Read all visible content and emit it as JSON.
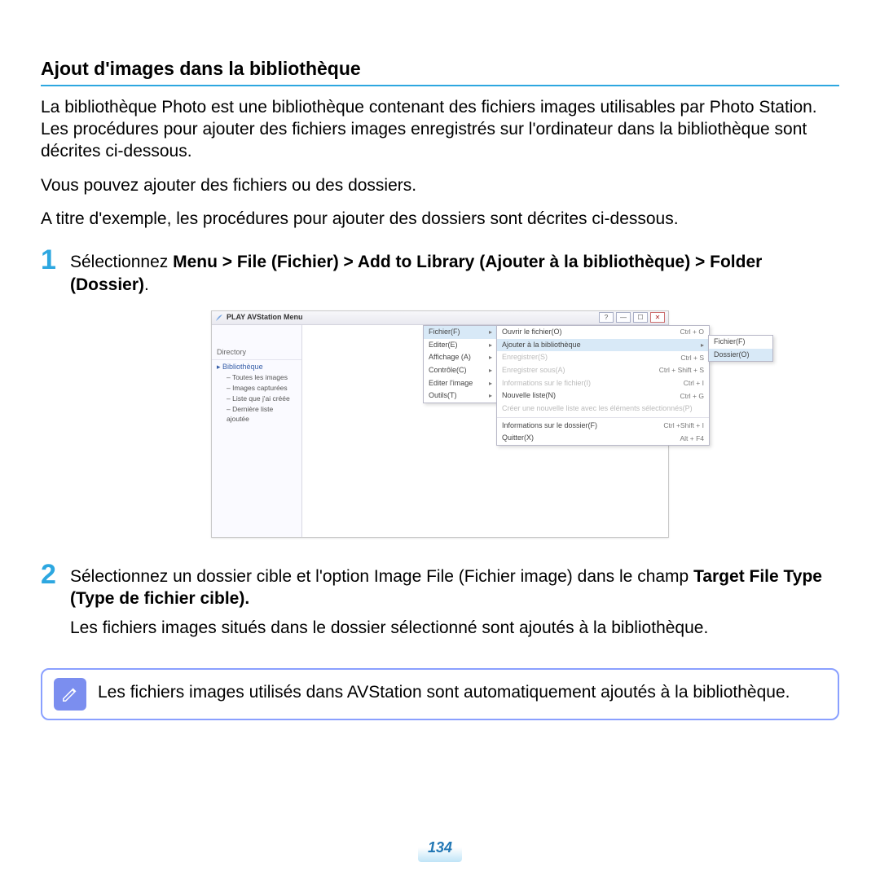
{
  "section_title": "Ajout d'images dans la bibliothèque",
  "intro_p1": "La bibliothèque Photo est une bibliothèque contenant des fichiers images utilisables par Photo Station. Les procédures pour ajouter des fichiers images enregistrés sur l'ordinateur dans la bibliothèque sont décrites ci-dessous.",
  "intro_p2": "Vous pouvez ajouter des fichiers ou des dossiers.",
  "intro_p3": "A titre d'exemple, les procédures pour ajouter des dossiers sont décrites ci-dessous.",
  "steps": {
    "s1_num": "1",
    "s1_prefix": "Sélectionnez ",
    "s1_bold": "Menu > File (Fichier) > Add to Library (Ajouter à la bibliothèque) > Folder (Dossier)",
    "s1_suffix": ".",
    "s2_num": "2",
    "s2_line1": "Sélectionnez un dossier cible et l'option Image File (Fichier image) dans le champ ",
    "s2_bold": "Target File Type (Type de fichier cible).",
    "s2_line2": "Les fichiers images situés dans le dossier sélectionné sont ajoutés à la bibliothèque."
  },
  "note_text": "Les fichiers images utilisés dans AVStation sont automatiquement ajoutés à la bibliothèque.",
  "page_number": "134",
  "app": {
    "title": "PLAY AVStation  Menu",
    "sidebar": {
      "section1": "Directory",
      "root": "Bibliothèque",
      "children": [
        "Toutes les images",
        "Images capturées",
        "Liste que j'ai créée",
        "Dernière liste ajoutée"
      ]
    },
    "menu1": [
      {
        "label": "Fichier(F)",
        "arrow": true
      },
      {
        "label": "Editer(E)",
        "arrow": true
      },
      {
        "label": "Affichage (A)",
        "arrow": true
      },
      {
        "label": "Contrôle(C)",
        "arrow": true
      },
      {
        "label": "Editer l'image",
        "arrow": true
      },
      {
        "label": "Outils(T)",
        "arrow": true
      }
    ],
    "menu2": [
      {
        "label": "Ouvrir le fichier(O)",
        "kc": "Ctrl + O"
      },
      {
        "label": "Ajouter à la bibliothèque",
        "arrow": true,
        "hl": true
      },
      {
        "label": "Enregistrer(S)",
        "kc": "Ctrl + S",
        "disabled": true
      },
      {
        "label": "Enregistrer sous(A)",
        "kc": "Ctrl + Shift + S",
        "disabled": true
      },
      {
        "label": "Informations sur le fichier(I)",
        "kc": "Ctrl + I",
        "disabled": true
      },
      {
        "label": "Nouvelle liste(N)",
        "kc": "Ctrl + G"
      },
      {
        "label": "Créer une nouvelle liste avec les éléments sélectionnés(P)",
        "disabled": true
      },
      {
        "sep": true
      },
      {
        "label": "Informations sur le dossier(F)",
        "kc": "Ctrl +Shift + I"
      },
      {
        "label": "Quitter(X)",
        "kc": "Alt + F4"
      }
    ],
    "menu3": [
      {
        "label": "Fichier(F)"
      },
      {
        "label": "Dossier(O)",
        "hl": true
      }
    ]
  }
}
